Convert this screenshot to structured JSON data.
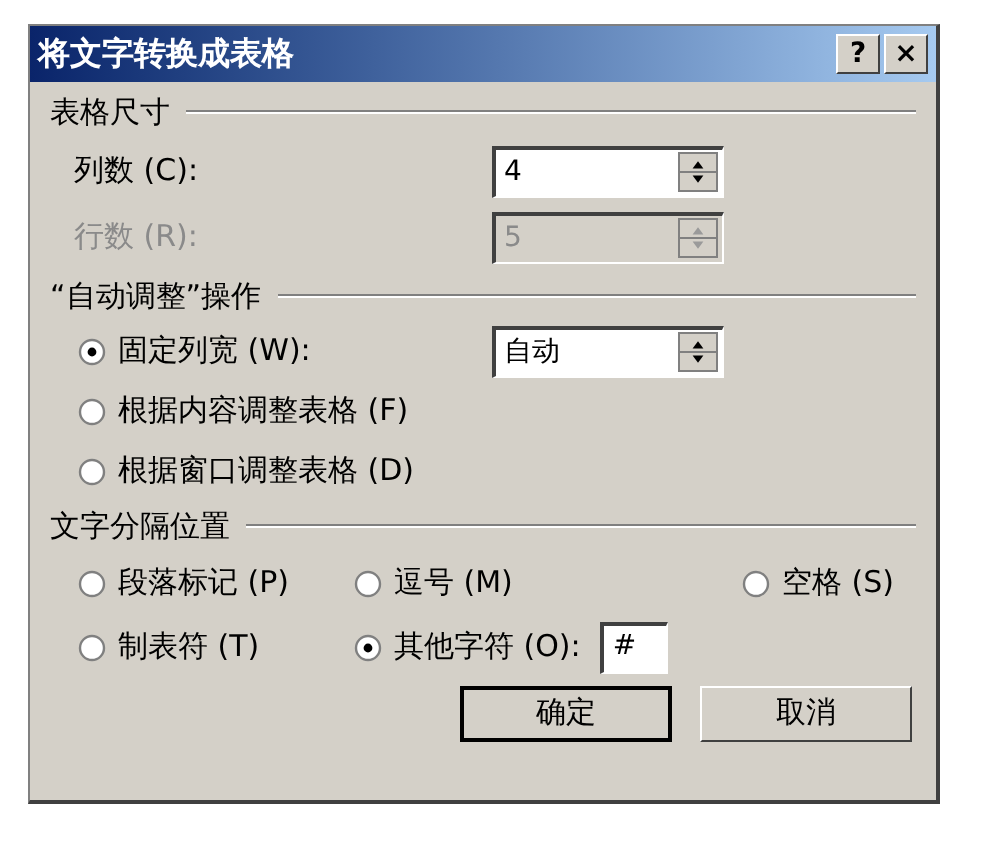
{
  "window": {
    "title": "将文字转换成表格",
    "title_buttons": [
      "?",
      "×"
    ]
  },
  "table_size": {
    "heading": "表格尺寸",
    "fields": [
      {
        "label": "列数 (C):",
        "value": "4",
        "disabled": false
      },
      {
        "label": "行数 (R):",
        "value": "5",
        "disabled": true
      }
    ]
  },
  "autofit": {
    "heading": "“自动调整”操作",
    "options": [
      {
        "label": "固定列宽 (W):",
        "selected": true,
        "spin_value": "自动"
      },
      {
        "label": "根据内容调整表格 (F)",
        "selected": false
      },
      {
        "label": "根据窗口调整表格 (D)",
        "selected": false
      }
    ]
  },
  "separator": {
    "heading": "文字分隔位置",
    "options": [
      {
        "label": "段落标记 (P)",
        "selected": false
      },
      {
        "label": "逗号 (M)",
        "selected": false
      },
      {
        "label": "空格 (S)",
        "selected": false
      },
      {
        "label": "制表符 (T)",
        "selected": false
      },
      {
        "label": "其他字符 (O):",
        "selected": true,
        "field_value": "#"
      }
    ]
  },
  "buttons": [
    {
      "label": "确定",
      "default": true
    },
    {
      "label": "取消",
      "default": false
    }
  ]
}
